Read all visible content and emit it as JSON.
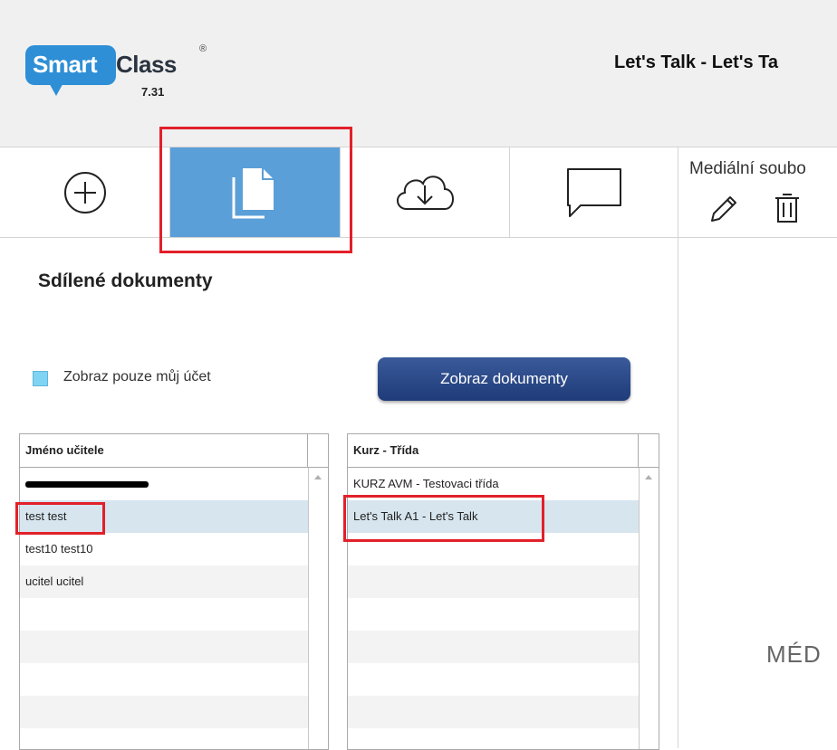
{
  "app": {
    "logo_smart": "Smart",
    "logo_class": "Class",
    "logo_registered": "®",
    "logo_version": "7.31",
    "title": "Let's Talk - Let's Ta"
  },
  "toolbar": {
    "buttons": [
      {
        "icon": "plus-circle-icon",
        "active": false
      },
      {
        "icon": "documents-icon",
        "active": true
      },
      {
        "icon": "cloud-download-icon",
        "active": false
      },
      {
        "icon": "chat-bubble-icon",
        "active": false
      }
    ],
    "accent_color": "#5a9fd8"
  },
  "media": {
    "label": "Mediální soubo",
    "edit_icon": "pencil-icon",
    "delete_icon": "trash-icon",
    "placeholder": "MÉD"
  },
  "shared": {
    "title": "Sdílené dokumenty",
    "checkbox_label": "Zobraz pouze můj účet",
    "show_button": "Zobraz dokumenty"
  },
  "teachers": {
    "header": "Jméno učitele",
    "rows": [
      "",
      "test test",
      "test10 test10",
      "ucitel ucitel",
      "",
      "",
      "",
      "",
      ""
    ],
    "selected_index": 1
  },
  "courses": {
    "header": "Kurz - Třída",
    "rows": [
      "KURZ AVM - Testovaci třída",
      "Let's Talk A1 - Let's Talk",
      "",
      "",
      "",
      "",
      "",
      "",
      ""
    ],
    "selected_index": 1
  },
  "highlight_color": "#e2202a"
}
